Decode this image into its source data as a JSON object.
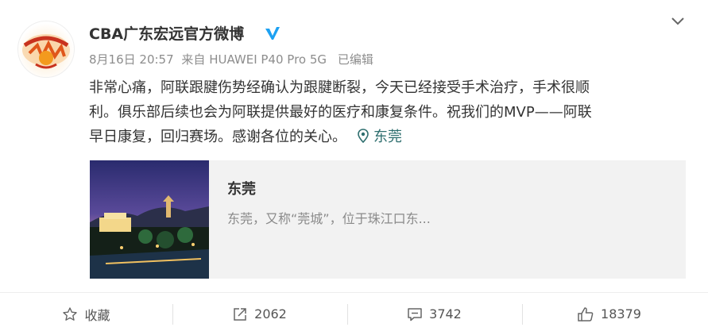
{
  "post": {
    "author_name": "CBA广东宏远官方微博",
    "date": "8月16日 20:57",
    "source": "来自 HUAWEI P40 Pro 5G",
    "edited": "已编辑",
    "content_lines": [
      "非常心痛，阿联跟腱伤势经确认为跟腱断裂，今天已经接受手术治疗，手术很顺",
      "利。俱乐部后续也会为阿联提供最好的医疗和康复条件。祝我们的MVP——阿联",
      "早日康复，回归赛场。感谢各位的关心。"
    ],
    "location_label": "东莞"
  },
  "card": {
    "title": "东莞",
    "description": "东莞，又称“莞城”，位于珠江口东..."
  },
  "actions": {
    "favorite_label": "收藏",
    "repost_count": "2062",
    "comment_count": "3742",
    "like_count": "18379"
  },
  "icons": {
    "verified": "verified-badge-icon",
    "chevron": "chevron-down-icon",
    "location": "location-pin-icon",
    "favorite": "star-icon",
    "repost": "repost-icon",
    "comment": "comment-icon",
    "like": "thumbs-up-icon"
  },
  "colors": {
    "verified": "#1da1f2",
    "location": "#2f6f6f",
    "muted": "#8d8d8d",
    "card_bg": "#f2f2f2"
  }
}
